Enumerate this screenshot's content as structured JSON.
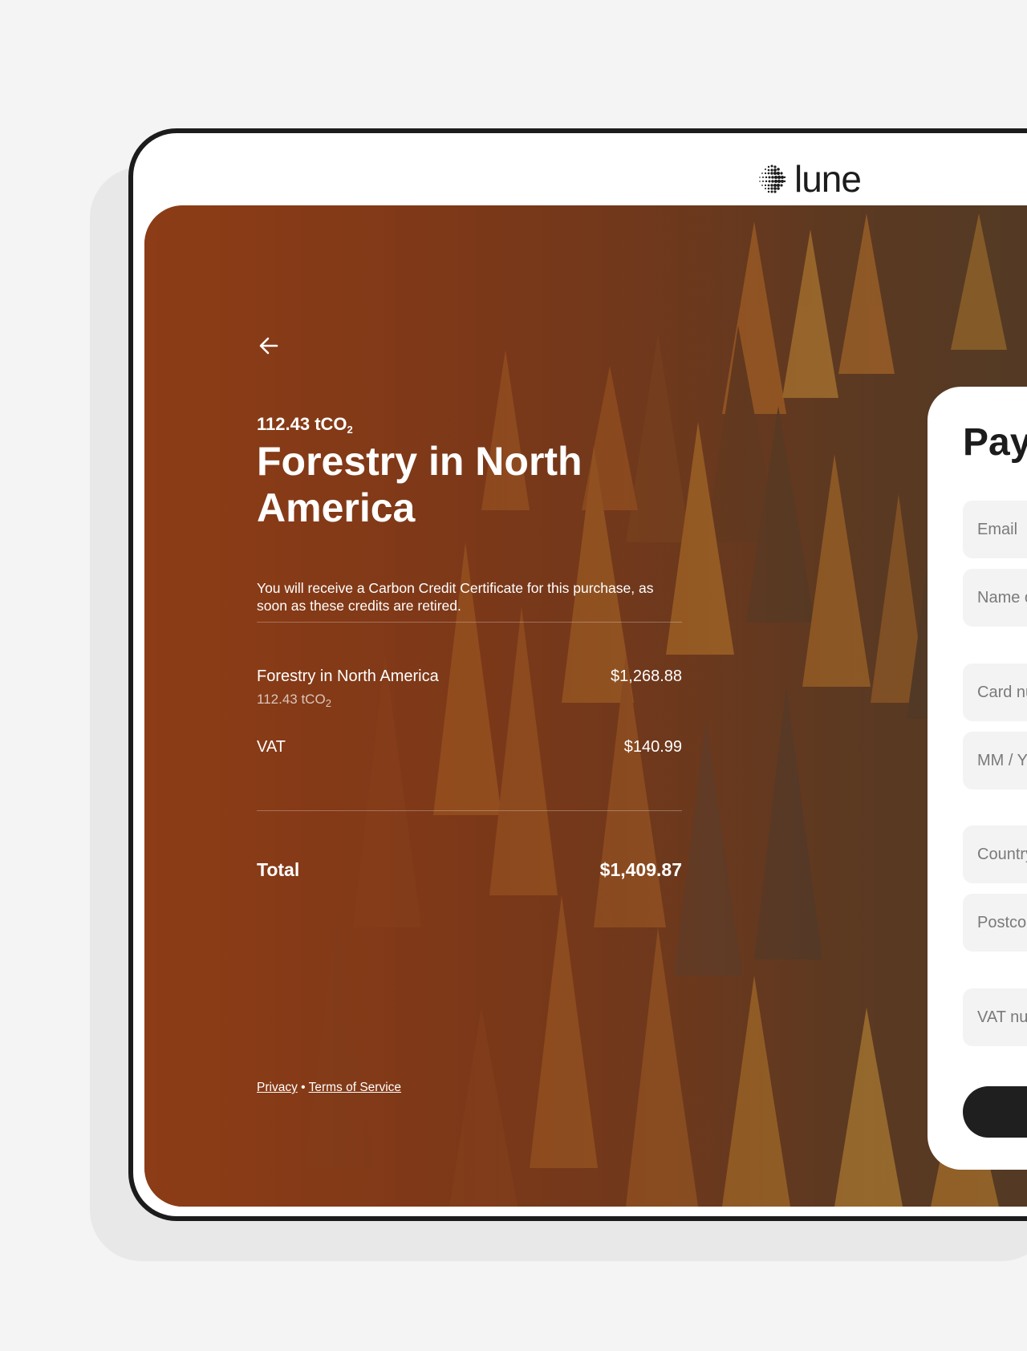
{
  "brand": {
    "name": "lune"
  },
  "project": {
    "amount_value": "112.43 tCO",
    "amount_sub": "2",
    "title": "Forestry in North America",
    "description": "You will receive a Carbon Credit Certificate for this purchase, as soon as these credits are retired."
  },
  "summary": {
    "items": [
      {
        "label": "Forestry in North America",
        "sub_value": "112.43 tCO",
        "sub_sub": "2",
        "amount": "$1,268.88"
      },
      {
        "label": "VAT",
        "amount": "$140.99"
      }
    ],
    "total_label": "Total",
    "total_amount": "$1,409.87"
  },
  "footer": {
    "privacy": "Privacy",
    "separator": "•",
    "terms": "Terms of Service"
  },
  "payment": {
    "title": "Pay by c",
    "fields": {
      "email": "Email",
      "name_on_card": "Name on card",
      "card_number": "Card number",
      "expiry": "MM / YY",
      "country": "Country",
      "postcode": "Postcode",
      "vat_number": "VAT number (optio"
    }
  },
  "colors": {
    "hero_base": "#8a3c16",
    "button": "#1f1f1f",
    "field_bg": "#f3f3f3"
  },
  "icons": {
    "back": "arrow-left-icon",
    "logo": "dot-circle-logo-icon"
  }
}
